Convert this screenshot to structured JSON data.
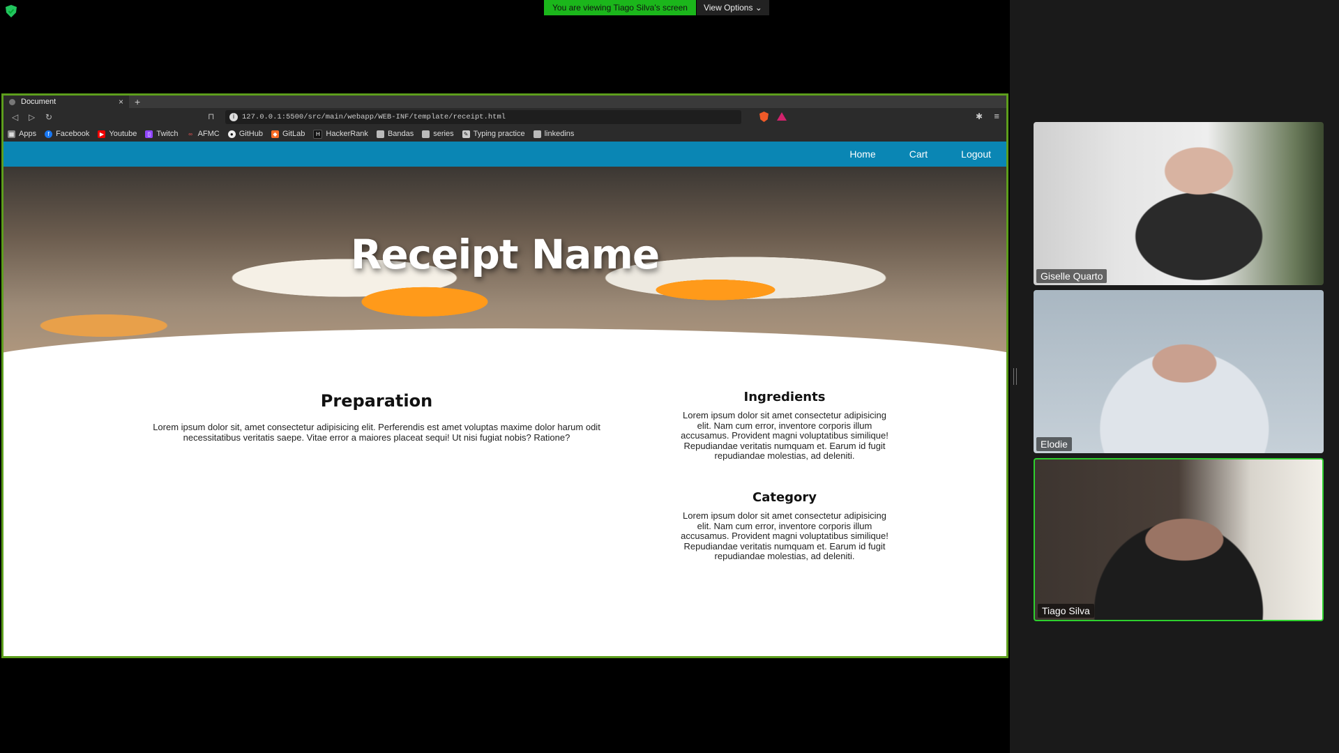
{
  "zoom": {
    "viewing_message": "You are viewing Tiago Silva's screen",
    "view_options_label": "View Options ⌄",
    "participants": [
      {
        "name": "Giselle Quarto"
      },
      {
        "name": "Elodie"
      },
      {
        "name": "Tiago Silva"
      }
    ],
    "active_speaker_color": "#2ed12e"
  },
  "browser": {
    "tab_title": "Document",
    "tab_close": "×",
    "new_tab": "+",
    "url": "127.0.0.1:5500/src/main/webapp/WEB-INF/template/receipt.html",
    "bookmarks": [
      {
        "label": "Apps",
        "icon": "apps-grid-icon"
      },
      {
        "label": "Facebook",
        "icon": "facebook-icon"
      },
      {
        "label": "Youtube",
        "icon": "youtube-icon"
      },
      {
        "label": "Twitch",
        "icon": "twitch-icon"
      },
      {
        "label": "AFMC",
        "icon": "link-icon"
      },
      {
        "label": "GitHub",
        "icon": "github-icon"
      },
      {
        "label": "GitLab",
        "icon": "gitlab-icon"
      },
      {
        "label": "HackerRank",
        "icon": "hackerrank-icon"
      },
      {
        "label": "Bandas",
        "icon": "folder-icon"
      },
      {
        "label": "series",
        "icon": "folder-icon"
      },
      {
        "label": "Typing practice",
        "icon": "typing-icon"
      },
      {
        "label": "linkedins",
        "icon": "folder-icon"
      }
    ]
  },
  "site": {
    "nav": {
      "home": "Home",
      "cart": "Cart",
      "logout": "Logout"
    },
    "nav_color": "#0a86b4",
    "hero_title": "Receipt Name",
    "preparation": {
      "title": "Preparation",
      "text": "Lorem ipsum dolor sit, amet consectetur adipisicing elit. Perferendis est amet voluptas maxime dolor harum odit necessitatibus veritatis saepe. Vitae error a maiores placeat sequi! Ut nisi fugiat nobis? Ratione?"
    },
    "ingredients": {
      "title": "Ingredients",
      "text": "Lorem ipsum dolor sit amet consectetur adipisicing elit. Nam cum error, inventore corporis illum accusamus. Provident magni voluptatibus similique! Repudiandae veritatis numquam et. Earum id fugit repudiandae molestias, ad deleniti."
    },
    "category": {
      "title": "Category",
      "text": "Lorem ipsum dolor sit amet consectetur adipisicing elit. Nam cum error, inventore corporis illum accusamus. Provident magni voluptatibus similique! Repudiandae veritatis numquam et. Earum id fugit repudiandae molestias, ad deleniti."
    }
  }
}
